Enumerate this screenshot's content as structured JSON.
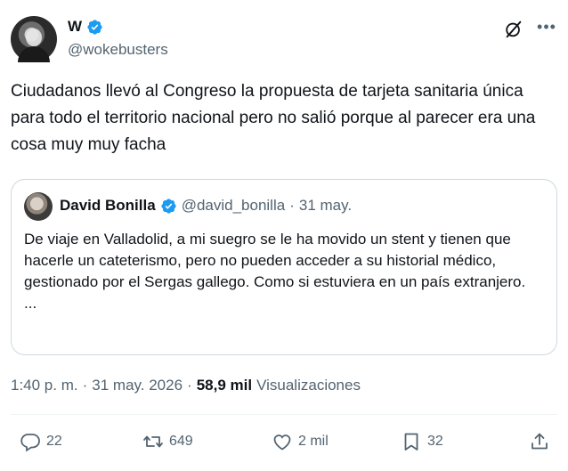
{
  "author": {
    "name": "W",
    "handle": "@wokebusters"
  },
  "tweet": {
    "text": "Ciudadanos llevó al Congreso la propuesta de tarjeta sanitaria única para todo el territorio nacional pero no salió porque al parecer era una cosa muy muy facha"
  },
  "quote": {
    "name": "David Bonilla",
    "handle": "@david_bonilla",
    "separator": "·",
    "date": "31 may.",
    "text": "De viaje en Valladolid, a mi suegro se le ha movido un stent y tienen que hacerle un cateterismo, pero no pueden acceder a su historial médico, gestionado por el Sergas gallego. Como si estuviera en un país extranjero.",
    "ellipsis": "..."
  },
  "meta": {
    "time": "1:40 p. m.",
    "sep1": "·",
    "date": "31 may. 2026",
    "sep2": "·",
    "views_count": "58,9 mil",
    "views_label": "Visualizaciones"
  },
  "actions": {
    "replies": "22",
    "reposts": "649",
    "likes": "2 mil",
    "bookmarks": "32"
  },
  "colors": {
    "verified": "#1d9bf0",
    "secondary_text": "#536471",
    "border": "#cfd9de"
  },
  "icons": [
    "verified-badge-icon",
    "grok-icon",
    "more-icon",
    "reply-icon",
    "repost-icon",
    "like-icon",
    "bookmark-icon",
    "share-icon"
  ]
}
